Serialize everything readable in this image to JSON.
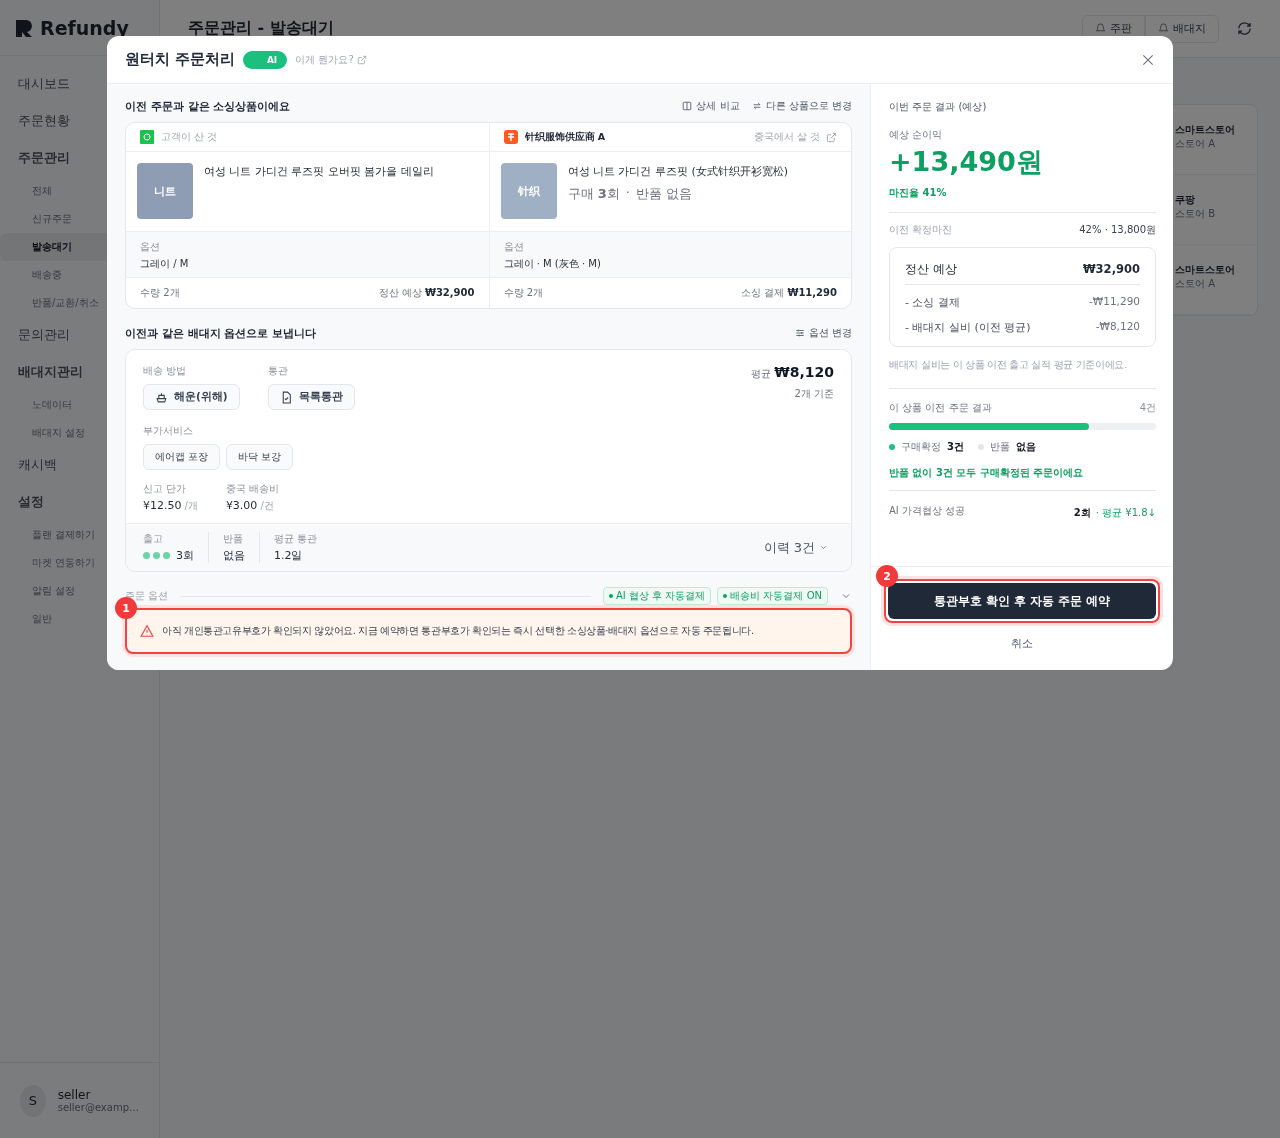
{
  "app": {
    "logo": "Refundy",
    "page_title": "주문관리 - 발송대기",
    "header_buttons": [
      {
        "label": "주판"
      },
      {
        "label": "배대지"
      }
    ],
    "sidebar": {
      "items": [
        {
          "label": "대시보드",
          "selected": false
        },
        {
          "label": "주문현황",
          "selected": false
        },
        {
          "label": "주문관리",
          "selected": false,
          "children": [
            {
              "label": "전체",
              "selected": false
            },
            {
              "label": "신규주문",
              "selected": false
            },
            {
              "label": "발송대기",
              "selected": true
            },
            {
              "label": "배송중",
              "selected": false
            },
            {
              "label": "반품/교환/취소",
              "selected": false
            }
          ]
        },
        {
          "label": "문의관리",
          "selected": false
        },
        {
          "label": "배대지관리",
          "selected": false,
          "children": [
            {
              "label": "노데이터",
              "selected": false
            },
            {
              "label": "배대지 설정",
              "selected": false
            }
          ]
        },
        {
          "label": "캐시백",
          "selected": false
        },
        {
          "label": "설정",
          "selected": false,
          "children": [
            {
              "label": "플랜 결제하기",
              "selected": false
            },
            {
              "label": "마켓 연동하기",
              "selected": false
            },
            {
              "label": "알림 설정",
              "selected": false
            },
            {
              "label": "일반",
              "selected": false
            }
          ]
        }
      ]
    },
    "user": {
      "initial": "S",
      "name": "seller",
      "email": "seller@examp…"
    },
    "store_cards": [
      {
        "market": "스마트스토어",
        "store": "스토어 A"
      },
      {
        "market": "쿠팡",
        "store": "스토어 B"
      },
      {
        "market": "스마트스토어",
        "store": "스토어 A"
      }
    ]
  },
  "modal": {
    "title": "원터치 주문처리",
    "ai_toggle": {
      "label": "AI",
      "on": true
    },
    "help_link": "이게 뭔가요?",
    "sourcing": {
      "heading": "이전 주문과 같은 소싱상품이에요",
      "actions": [
        "상세 비교",
        "다른 상품으로 변경"
      ],
      "columns": [
        {
          "kind": "customer",
          "source": "고객이 산 것",
          "thumb": "니트",
          "name": "여성 니트 가디건 루즈핏 오버핏 봄가을 데일리",
          "option_label": "옵션",
          "option": "그레이 / M",
          "qty": "수량 2개",
          "amount_label": "정산 예상",
          "amount": "₩32,900"
        },
        {
          "kind": "supplier",
          "source": "针织服饰供应商 A",
          "link": "중국에서 살 것",
          "thumb": "针织",
          "name": "여성 니트 가디건 루즈핏 (女式针织开衫宽松)",
          "purchases": "구매 **3**회",
          "separator": "·",
          "returns": "반품 없음",
          "option_label": "옵션",
          "option": "그레이 · M (灰色 · M)",
          "qty": "수량 2개",
          "amount_label": "소싱 결제",
          "amount": "₩11,290"
        }
      ]
    },
    "shipping": {
      "heading": "이전과 같은 배대지 옵션으로 보냅니다",
      "action": "옵션 변경",
      "method_label": "배송 방법",
      "method": "해운(위해)",
      "customs_label": "통관",
      "customs": "목록통관",
      "avg_label": "평균",
      "avg": "₩8,120",
      "avg_note": "2개 기준",
      "addons_label": "부가서비스",
      "addons": [
        "에어캡 포장",
        "바닥 보강"
      ],
      "fees": [
        {
          "label": "신고 단가",
          "value": "¥12.50",
          "unit": "/개"
        },
        {
          "label": "중국 배송비",
          "value": "¥3.00",
          "unit": "/건"
        }
      ],
      "stats": [
        {
          "label": "출고",
          "value": "3회",
          "stars": 3
        },
        {
          "label": "반품",
          "value": "없음"
        },
        {
          "label": "평균 통관",
          "value": "1.2일"
        }
      ],
      "history": "이력 3건"
    },
    "order_options": {
      "label": "주문 옵션",
      "tags": [
        {
          "label": "AI 협상 후 자동결제",
          "on": true
        },
        {
          "label": "배송비 자동결제 ON",
          "on": true
        }
      ]
    },
    "warning": {
      "badge": "1",
      "text": "아직 개인통관고유부호가 확인되지 않았어요. 지금 예약하면 통관부호가 확인되는 즉시 선택한 소싱상품·배대지 옵션으로 자동 주문됩니다."
    },
    "result": {
      "title": "이번 주문 결과 (예상)",
      "profit_label": "예상 순이익",
      "profit": "+13,490원",
      "margin": "마진율 41%",
      "prev_label": "이전 확정마진",
      "prev_value": "42% · 13,800원",
      "breakdown": [
        {
          "kind": "total",
          "label": "정산 예상",
          "value": "₩32,900"
        },
        {
          "kind": "deduction",
          "label": "- 소싱 결제",
          "value": "-₩11,290"
        },
        {
          "kind": "deduction",
          "label": "- 배대지 실비 (이전 평균)",
          "value": "-₩8,120"
        }
      ],
      "note": "배대지 실비는 이 상품 이전 출고 실적 평균 기준이에요.",
      "history_title": "이 상품 이전 주문 결과",
      "history_count": "4건",
      "level": 0.75,
      "legend": [
        {
          "label": "구매확정",
          "value": "3건",
          "color": "#1dbf7f"
        },
        {
          "label": "반품",
          "value": "없음",
          "color": "#e2e5e9"
        }
      ],
      "history_message": "반품 없이 3건 모두 구매확정된 주문이에요",
      "nego_label": "AI 가격협상 성공",
      "nego_count": "2회",
      "nego_detail": "· 평균 ¥1.8↓"
    },
    "primary": {
      "badge": "2",
      "label": "통관부호 확인 후 자동 주문 예약"
    },
    "cancel": "취소"
  }
}
